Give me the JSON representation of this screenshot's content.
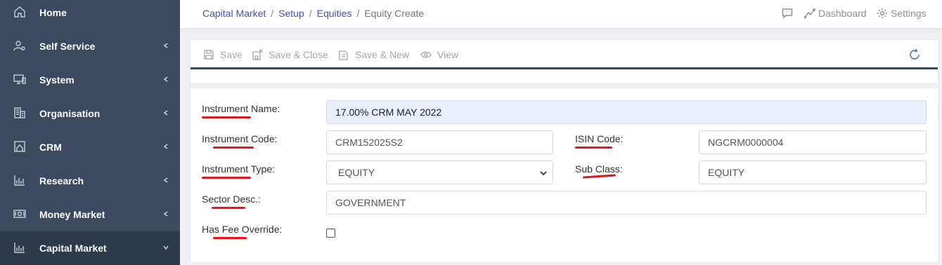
{
  "sidebar": {
    "items": [
      {
        "label": "Home",
        "icon": "home-icon"
      },
      {
        "label": "Self Service",
        "icon": "user-cog-icon"
      },
      {
        "label": "System",
        "icon": "monitor-icon"
      },
      {
        "label": "Organisation",
        "icon": "building-icon"
      },
      {
        "label": "CRM",
        "icon": "contact-frame-icon"
      },
      {
        "label": "Research",
        "icon": "bar-chart-icon"
      },
      {
        "label": "Money Market",
        "icon": "money-icon"
      },
      {
        "label": "Capital Market",
        "icon": "bar-chart-icon"
      }
    ]
  },
  "breadcrumb": {
    "items": [
      "Capital Market",
      "Setup",
      "Equities"
    ],
    "current": "Equity Create"
  },
  "header": {
    "dashboard_label": "Dashboard",
    "settings_label": "Settings"
  },
  "toolbar": {
    "save_label": "Save",
    "save_close_label": "Save & Close",
    "save_new_label": "Save & New",
    "view_label": "View"
  },
  "form": {
    "instrument_name": {
      "label": "Instrument Name:",
      "value": "17.00% CRM MAY 2022"
    },
    "instrument_code": {
      "label": "Instrument Code:",
      "value": "CRM152025S2"
    },
    "isin_code": {
      "label": "ISIN Code:",
      "value": "NGCRM0000004"
    },
    "instrument_type": {
      "label": "Instrument Type:",
      "value": "EQUITY"
    },
    "sub_class": {
      "label": "Sub Class:",
      "value": "EQUITY"
    },
    "sector_desc": {
      "label": "Sector Desc.:",
      "value": "GOVERNMENT"
    },
    "has_fee_override": {
      "label": "Has Fee Override:",
      "checked": false
    }
  },
  "colors": {
    "sidebar_bg": "#3b4a5e",
    "sidebar_active": "#2d3a4b",
    "link": "#3f51b5",
    "annotation_underline": "#e01818",
    "filled_input": "#e8f0fe"
  }
}
